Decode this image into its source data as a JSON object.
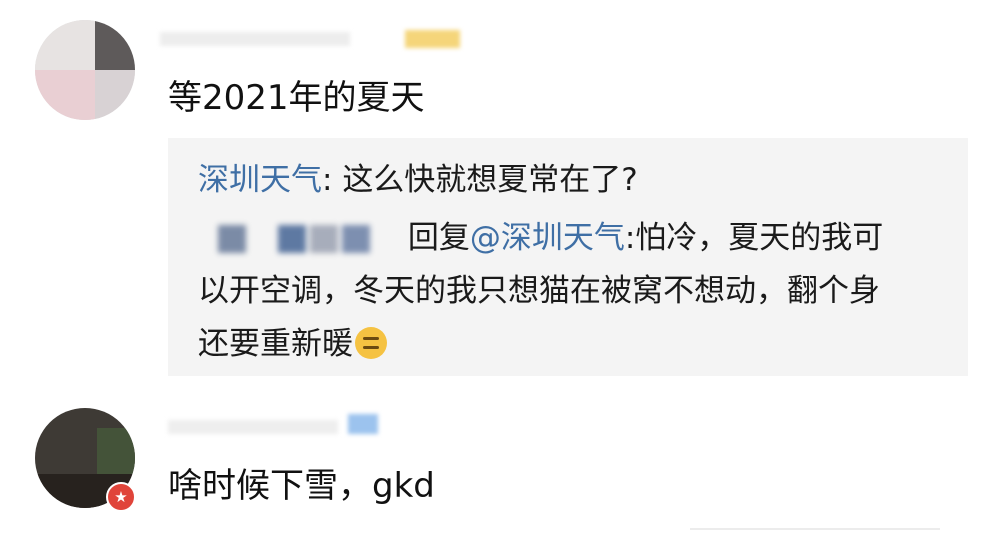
{
  "comments": [
    {
      "text": "等2021年的夏天",
      "reply_preview": {
        "parent": {
          "author": "深圳天气",
          "separator": ": ",
          "text": "这么快就想夏常在了?"
        },
        "child": {
          "reply_word": "回复",
          "mention": "@深圳天气",
          "text_line1": ":怕冷，夏天的我可",
          "text_line2": "以开空调，冬天的我只想猫在被窝不想动，翻个身",
          "text_line3": "还要重新暖"
        },
        "emoji": "expressionless-face"
      }
    },
    {
      "text": "啥时候下雪，gkd",
      "badge_icon": "star-icon",
      "badge_color": "#e0443a"
    }
  ],
  "colors": {
    "link": "#3f6fa5",
    "reply_background": "#f4f4f4",
    "text": "#1a1a1a"
  }
}
